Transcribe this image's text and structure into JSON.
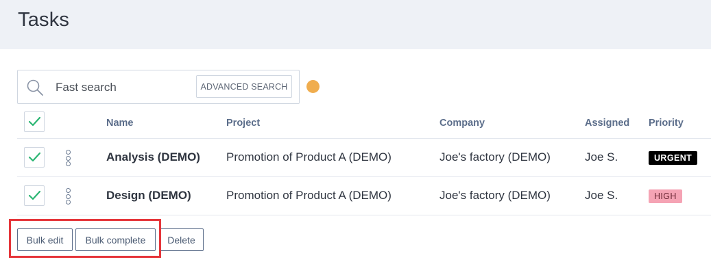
{
  "page": {
    "title": "Tasks"
  },
  "search": {
    "placeholder": "Fast search",
    "advanced_label": "ADVANCED SEARCH",
    "icon": "search-icon",
    "status_dot_color": "#f0ad4e"
  },
  "table": {
    "columns": {
      "name": "Name",
      "project": "Project",
      "company": "Company",
      "assigned": "Assigned",
      "priority": "Priority"
    },
    "select_all_checked": true,
    "rows": [
      {
        "checked": true,
        "name": "Analysis (DEMO)",
        "project": "Promotion of Product A (DEMO)",
        "company": "Joe's factory (DEMO)",
        "assigned": "Joe S.",
        "priority": "URGENT",
        "priority_color": "#000000"
      },
      {
        "checked": true,
        "name": "Design (DEMO)",
        "project": "Promotion of Product A (DEMO)",
        "company": "Joe's factory (DEMO)",
        "assigned": "Joe S.",
        "priority": "HIGH",
        "priority_color": "#f5a3b4"
      }
    ]
  },
  "actions": {
    "bulk_edit": "Bulk edit",
    "bulk_complete": "Bulk complete",
    "delete": "Delete",
    "highlight_color": "#e5353a"
  },
  "colors": {
    "header_bg": "#eef1f6",
    "check_color": "#2bb673",
    "header_text": "#5b6d8a"
  }
}
